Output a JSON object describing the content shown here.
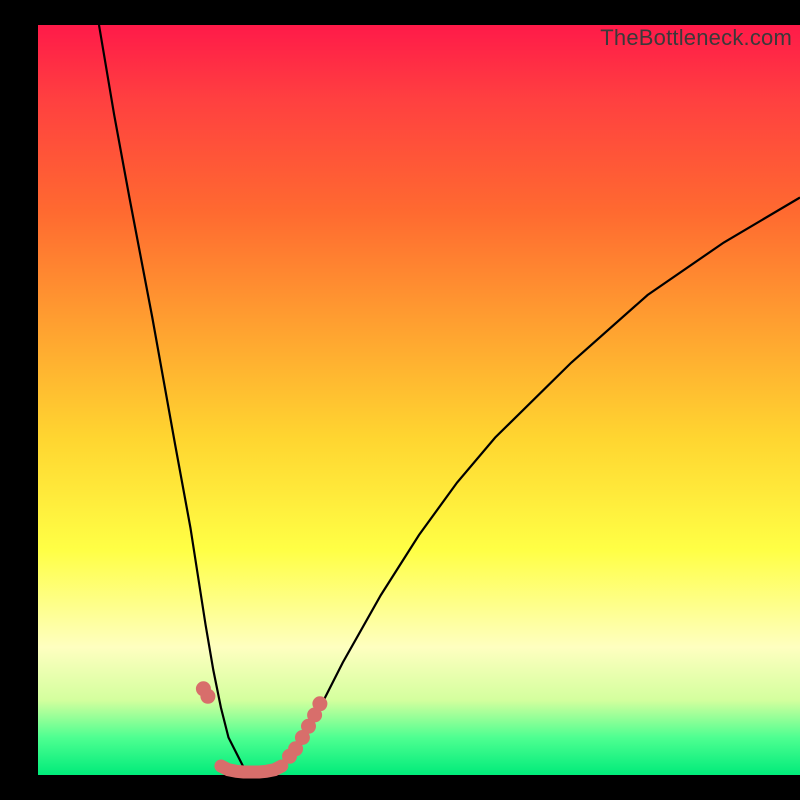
{
  "watermark": "TheBottleneck.com",
  "chart_data": {
    "type": "line",
    "title": "",
    "xlabel": "",
    "ylabel": "",
    "xlim": [
      0,
      100
    ],
    "ylim": [
      0,
      100
    ],
    "series": [
      {
        "name": "bottleneck-curve",
        "x": [
          8,
          10,
          12,
          15,
          18,
          20,
          22,
          23,
          24,
          25,
          26,
          27,
          28,
          29,
          30,
          31,
          32,
          34,
          36,
          38,
          40,
          45,
          50,
          55,
          60,
          70,
          80,
          90,
          100
        ],
        "values": [
          100,
          88,
          77,
          61,
          44,
          33,
          20,
          14,
          9,
          5,
          3,
          1,
          0,
          0,
          0,
          0,
          1,
          3,
          7,
          11,
          15,
          24,
          32,
          39,
          45,
          55,
          64,
          71,
          77
        ]
      },
      {
        "name": "marker-cluster-left",
        "x": [
          21.7,
          22.3
        ],
        "values": [
          11.5,
          10.5
        ]
      },
      {
        "name": "marker-cluster-right",
        "x": [
          33.0,
          33.8,
          34.7,
          35.5,
          36.3,
          37.0
        ],
        "values": [
          2.5,
          3.5,
          5.0,
          6.5,
          8.0,
          9.5
        ]
      },
      {
        "name": "bottom-band",
        "x": [
          24,
          25,
          26,
          27,
          28,
          29,
          30,
          31,
          32
        ],
        "values": [
          1.2,
          0.7,
          0.5,
          0.4,
          0.4,
          0.4,
          0.5,
          0.7,
          1.2
        ]
      }
    ],
    "colors": {
      "curve": "#000000",
      "markers": "#d86e6b",
      "band": "#d86e6b"
    }
  }
}
